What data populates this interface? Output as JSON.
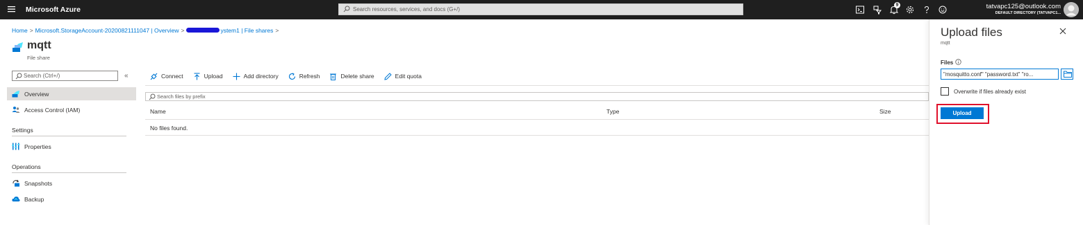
{
  "topbar": {
    "brand": "Microsoft Azure",
    "search_placeholder": "Search resources, services, and docs (G+/)",
    "notification_count": "9",
    "account_email": "tatvapc125@outlook.com",
    "account_directory": "DEFAULT DIRECTORY (TATVAPC1..."
  },
  "breadcrumb": {
    "home": "Home",
    "storage_account": "Microsoft.StorageAccount-20200821111047 | Overview",
    "file_service_suffix": "ystem1 | File shares"
  },
  "header": {
    "title": "mqtt",
    "subtitle": "File share"
  },
  "sidebar": {
    "search_placeholder": "Search (Ctrl+/)",
    "collapse_glyph": "«",
    "items": [
      {
        "label": "Overview",
        "icon": "file-share-icon"
      },
      {
        "label": "Access Control (IAM)",
        "icon": "people-icon"
      }
    ],
    "sections": [
      {
        "label": "Settings",
        "items": [
          {
            "label": "Properties",
            "icon": "properties-icon"
          }
        ]
      },
      {
        "label": "Operations",
        "items": [
          {
            "label": "Snapshots",
            "icon": "snapshots-icon"
          },
          {
            "label": "Backup",
            "icon": "backup-icon"
          }
        ]
      }
    ]
  },
  "toolbar": {
    "connect": "Connect",
    "upload": "Upload",
    "add_directory": "Add directory",
    "refresh": "Refresh",
    "delete_share": "Delete share",
    "edit_quota": "Edit quota"
  },
  "files": {
    "search_placeholder": "Search files by prefix",
    "columns": [
      "Name",
      "Type",
      "Size"
    ],
    "empty_message": "No files found."
  },
  "upload_panel": {
    "title": "Upload files",
    "subtitle": "mqtt",
    "files_label": "Files",
    "files_value": "\"mosquitto.conf\" \"password.txt\" \"ro...",
    "overwrite_label": "Overwrite if files already exist",
    "upload_button": "Upload"
  },
  "colors": {
    "topbar_bg": "#1f1f1f",
    "accent": "#0078d4",
    "highlight": "#e0102b"
  }
}
